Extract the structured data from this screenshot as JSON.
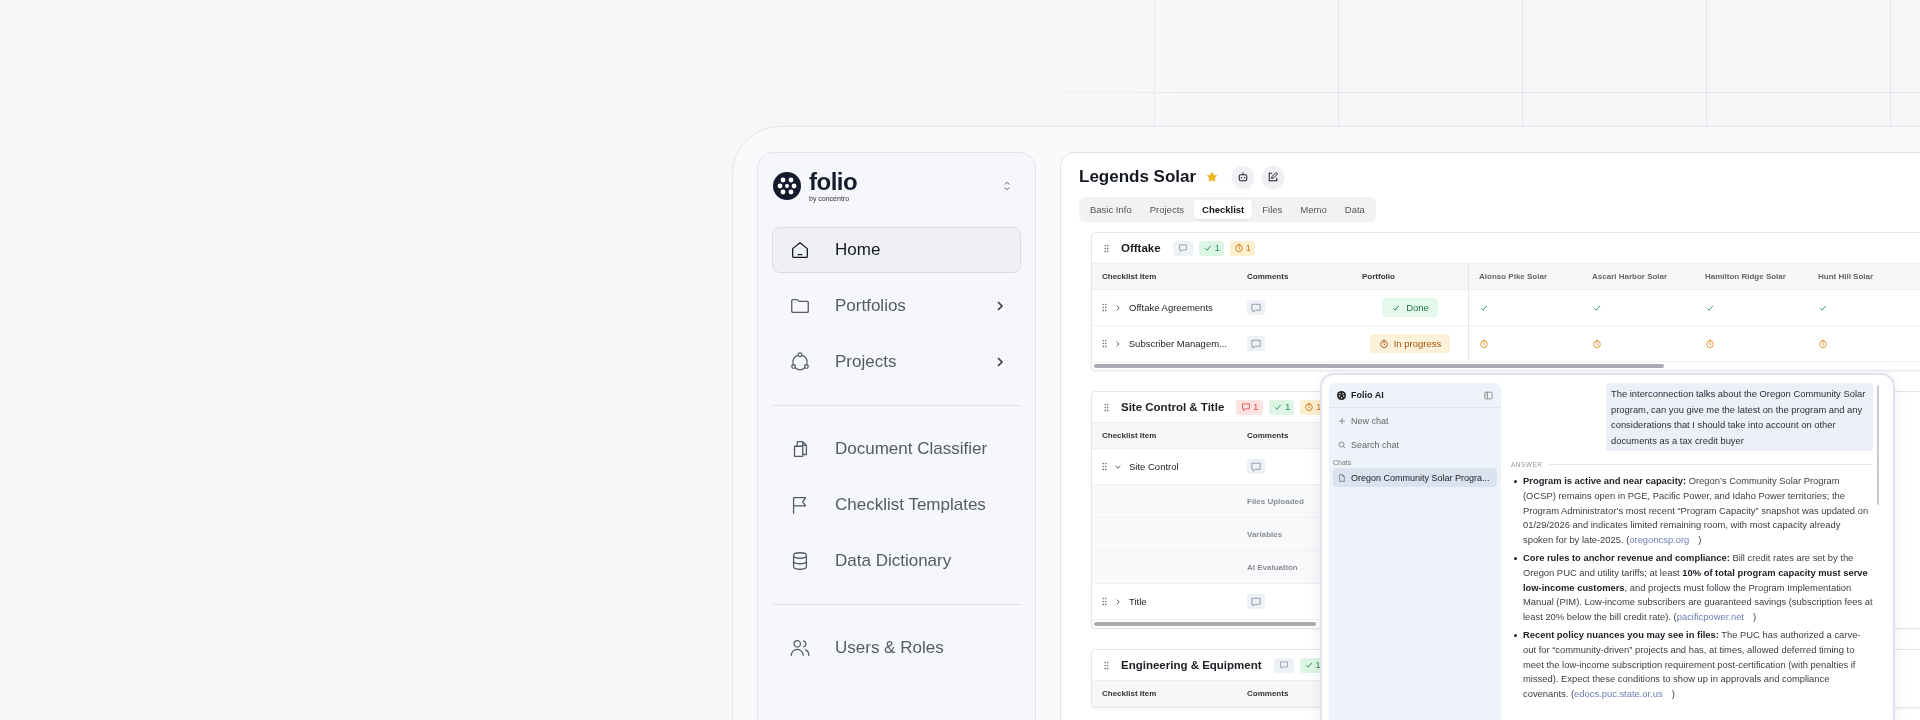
{
  "sidebar": {
    "brand": "folio",
    "tagline": "by concentro",
    "groups": [
      [
        {
          "label": "Home",
          "selected": true,
          "has_submenu": false
        },
        {
          "label": "Portfolios",
          "selected": false,
          "has_submenu": true
        },
        {
          "label": "Projects",
          "selected": false,
          "has_submenu": true
        }
      ],
      [
        {
          "label": "Document Classifier",
          "selected": false,
          "has_submenu": false
        },
        {
          "label": "Checklist Templates",
          "selected": false,
          "has_submenu": false
        },
        {
          "label": "Data Dictionary",
          "selected": false,
          "has_submenu": false
        }
      ],
      [
        {
          "label": "Users & Roles",
          "selected": false,
          "has_submenu": false
        }
      ]
    ]
  },
  "project": {
    "title": "Legends Solar",
    "starred": true
  },
  "tabs": [
    {
      "label": "Basic Info",
      "selected": false
    },
    {
      "label": "Projects",
      "selected": false
    },
    {
      "label": "Checklist",
      "selected": true
    },
    {
      "label": "Files",
      "selected": false
    },
    {
      "label": "Memo",
      "selected": false
    },
    {
      "label": "Data",
      "selected": false
    }
  ],
  "sections": [
    {
      "title": "Offtake",
      "badges": [
        {
          "kind": "comments"
        },
        {
          "kind": "done",
          "count": "1"
        },
        {
          "kind": "progress",
          "count": "1"
        }
      ],
      "columns": [
        "Checklist Item",
        "Comments",
        "Portfolio",
        "Alonso Pike Solar",
        "Ascari Harbor Solar",
        "Hamilton Ridge Solar",
        "Hunt Hill Solar"
      ],
      "rows": [
        {
          "kind": "item",
          "label": "Offtake Agreements",
          "expanded": false,
          "done": true,
          "status_label": "Done",
          "cells": [
            {
              "done": true
            },
            {
              "done": true
            },
            {
              "done": true
            },
            {
              "done": true
            }
          ]
        },
        {
          "kind": "item",
          "label": "Subscriber Managem...",
          "expanded": false,
          "done": false,
          "status_label": "In progress",
          "cells": [
            {
              "done": false
            },
            {
              "done": false
            },
            {
              "done": false
            },
            {
              "done": false
            }
          ]
        }
      ]
    },
    {
      "title": "Site Control & Title",
      "badges": [
        {
          "kind": "comments",
          "count": "1"
        },
        {
          "kind": "done",
          "count": "1"
        },
        {
          "kind": "progress",
          "count": "1"
        }
      ],
      "columns": [
        "Checklist Item",
        "Comments"
      ],
      "rows": [
        {
          "kind": "item",
          "label": "Site Control",
          "expanded": true
        },
        {
          "kind": "detail",
          "label": "Files Uploaded"
        },
        {
          "kind": "detail",
          "label": "Variables"
        },
        {
          "kind": "detail",
          "label": "AI Evaluation"
        },
        {
          "kind": "item",
          "label": "Title",
          "expanded": false
        }
      ]
    },
    {
      "title": "Engineering & Equipment",
      "badges": [
        {
          "kind": "comments"
        },
        {
          "kind": "done",
          "count": "1"
        }
      ],
      "columns": [
        "Checklist Item",
        "Comments"
      ]
    }
  ],
  "assistant": {
    "title": "Folio AI",
    "actions": [
      {
        "kind": "new",
        "label": "New chat"
      },
      {
        "kind": "search",
        "label": "Search chat"
      }
    ],
    "chats_heading": "Chats",
    "chats": [
      {
        "label": "Oregon Community Solar Progra...",
        "selected": true
      }
    ],
    "question": "The interconnection talks about the Oregon Community Solar program, can you give me the latest on the program and any considerations that I should take into account on other documents as a tax credit buyer",
    "answer_heading": "ANSWER",
    "answer": [
      {
        "text": "**Program is active and near capacity:** Oregon’s Community Solar Program (OCSP) remains open in PGE, Pacific Power, and Idaho Power territories; the Program Administrator’s most recent “Program Capacity” snapshot was updated on 01/29/2026 and indicates limited remaining room, with most capacity already spoken for by late-2025. (",
        "link": "oregoncsp.org",
        "after": ")"
      },
      {
        "text": "**Core rules to anchor revenue and compliance:** Bill credit rates are set by the Oregon PUC and utility tariffs; at least **10% of total program capacity must serve low-income customers**, and projects must follow the Program Implementation Manual (PIM). Low-income subscribers are guaranteed savings (subscription fees at least 20% below the bill credit rate). (",
        "link": "pacificpower.net",
        "after": ")"
      },
      {
        "text": "**Recent policy nuances you may see in files:** The PUC has authorized a carve-out for “community-driven” projects and has, at times, allowed deferred timing to meet the low-income subscription requirement post-certification (with penalties if missed). Expect these conditions to show up in approvals and compliance covenants. (",
        "link": "edocs.puc.state.or.us",
        "after": ")"
      }
    ]
  }
}
